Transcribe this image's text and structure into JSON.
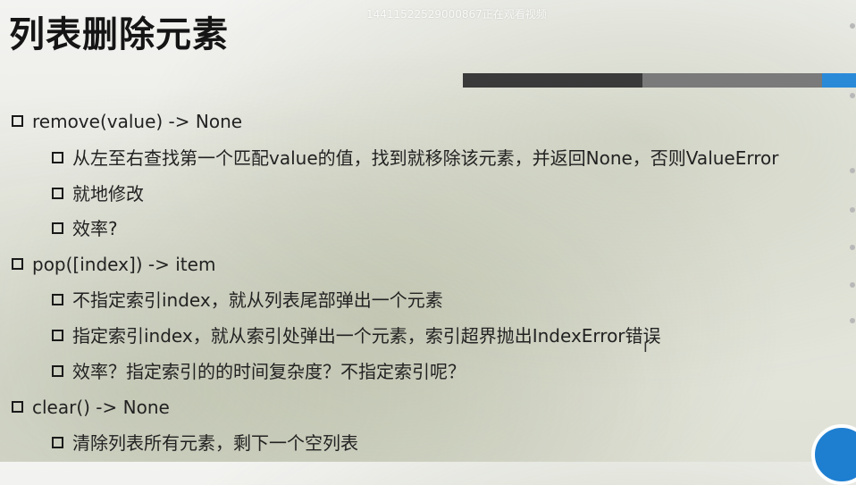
{
  "slide": {
    "title": "列表删除元素",
    "watermark": "14411522529000867正在观看视频",
    "items": [
      {
        "text": "remove(value) -> None"
      },
      {
        "text": "从左至右查找第一个匹配value的值，找到就移除该元素，并返回None，否则ValueError"
      },
      {
        "text": "就地修改"
      },
      {
        "text": "效率?"
      },
      {
        "text": "pop([index]) -> item"
      },
      {
        "text": "不指定索引index，就从列表尾部弹出一个元素"
      },
      {
        "text": "指定索引index，就从索引处弹出一个元素，索引超界抛出IndexError错误"
      },
      {
        "text": "效率？指定索引的的时间复杂度？不指定索引呢？"
      },
      {
        "text": "clear() -> None"
      },
      {
        "text": "清除列表所有元素，剩下一个空列表"
      }
    ]
  },
  "colors": {
    "title": "#151515",
    "progress_dark": "#3a3a3a",
    "progress_mid": "#7a7a7a",
    "progress_accent": "#2a8ad8",
    "logo": "#1e7fd1"
  }
}
